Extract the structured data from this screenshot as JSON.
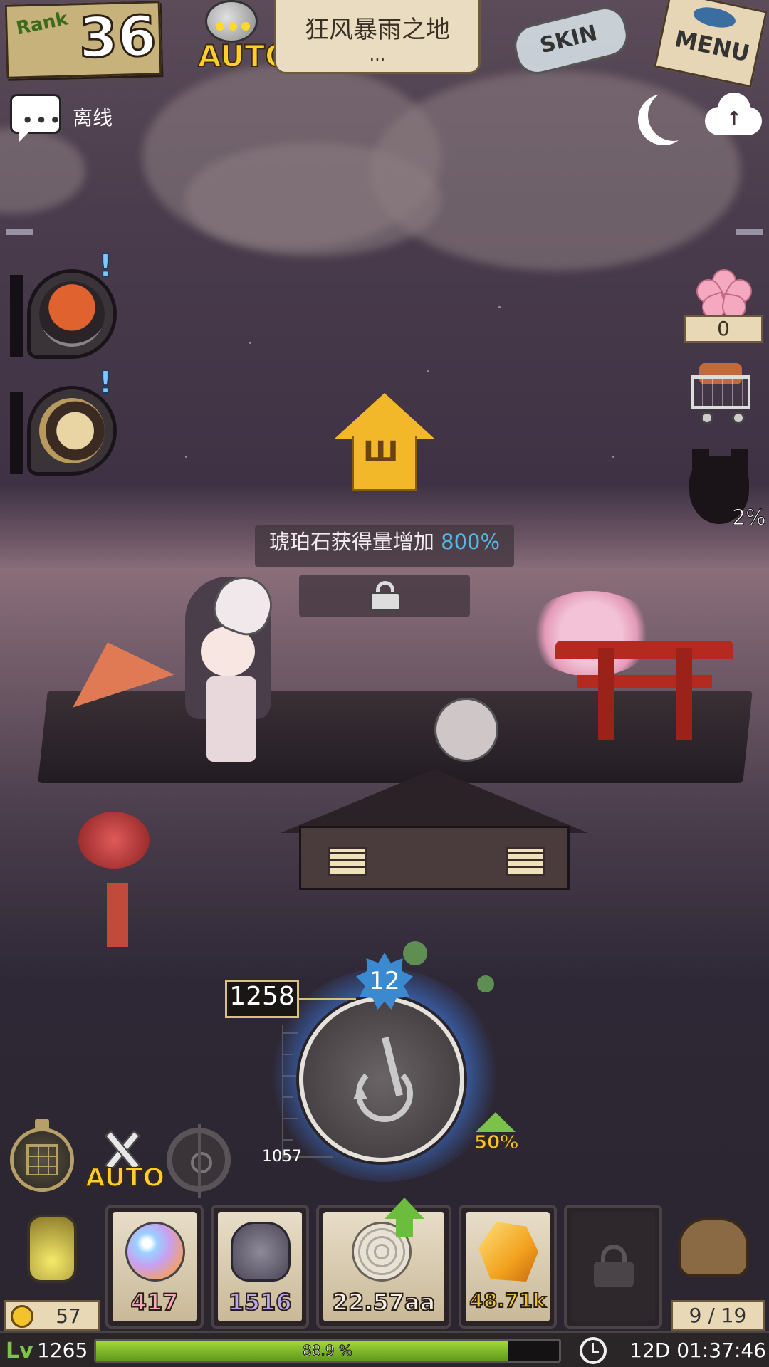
{
  "header": {
    "rank_label": "Rank",
    "rank_value": "36",
    "auto_label": "AUTO",
    "location_title": "狂风暴雨之地",
    "location_sub": "...",
    "skin_label": "SKIN",
    "menu_label": "MENU"
  },
  "status": {
    "chat_icon": "chat-bubble-icon",
    "connection": "离线",
    "night_icon": "moon-icon",
    "cloud_icon": "cloud-upload-icon"
  },
  "side_right": {
    "sakura_count": "0",
    "mask_progress": "2%"
  },
  "buff": {
    "text": "琥珀石获得量增加",
    "percent": "800%"
  },
  "fishing": {
    "depth_current": "1258",
    "depth_min": "1057",
    "level": "12",
    "boost": "50%"
  },
  "tools": {
    "auto_fight_label": "AUTO"
  },
  "tray": {
    "lamp_value": "57",
    "slots": [
      {
        "value": "417",
        "color": "#f2a9b8"
      },
      {
        "value": "1516",
        "color": "#b8a8e8"
      },
      {
        "value": "22.57aa",
        "color": "#f4f0e6"
      },
      {
        "value": "48.71k",
        "color": "#f2c42a"
      }
    ],
    "bag_value": "9 / 19"
  },
  "footer": {
    "level": "1265",
    "xp_percent_text": "88.9 %",
    "xp_fraction": 0.889,
    "timer": "12D 01:37:46"
  },
  "colors": {
    "accent_blue": "#56b8e8",
    "xp_green": "#7ec24a",
    "auto_yellow": "#ffce2a"
  }
}
